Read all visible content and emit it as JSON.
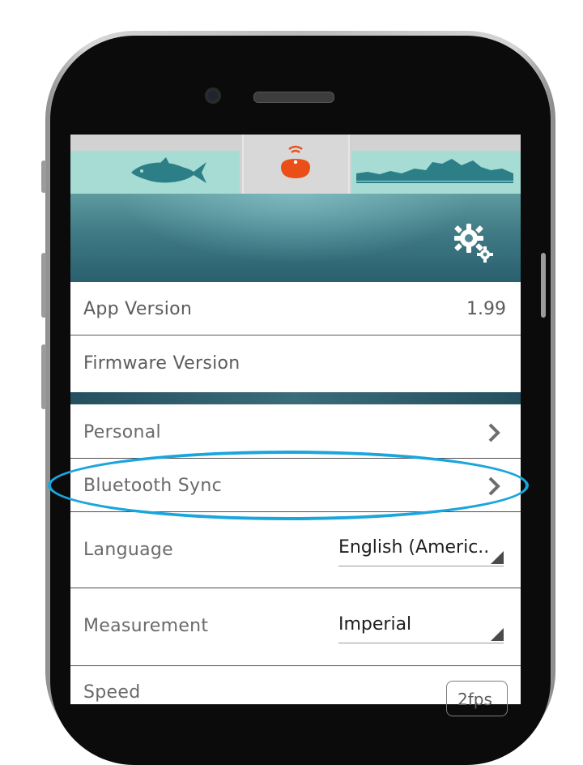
{
  "modes": {
    "fish_icon": "fish-icon",
    "device_icon": "sonar-device-icon",
    "terrain_icon": "bottom-contour-icon"
  },
  "header": {
    "settings_icon": "gear-icon"
  },
  "info": {
    "app_version_label": "App Version",
    "app_version_value": "1.99",
    "firmware_version_label": "Firmware Version"
  },
  "menu": {
    "personal_label": "Personal",
    "bluetooth_sync_label": "Bluetooth Sync"
  },
  "settings": {
    "language_label": "Language",
    "language_value": "English (Americ..",
    "measurement_label": "Measurement",
    "measurement_value": "Imperial",
    "speed_label": "Speed",
    "speed_value": "2fps"
  },
  "colors": {
    "accent_teal": "#a7dcd5",
    "device_orange": "#ea4f18",
    "highlight_blue": "#1ba5dd"
  }
}
